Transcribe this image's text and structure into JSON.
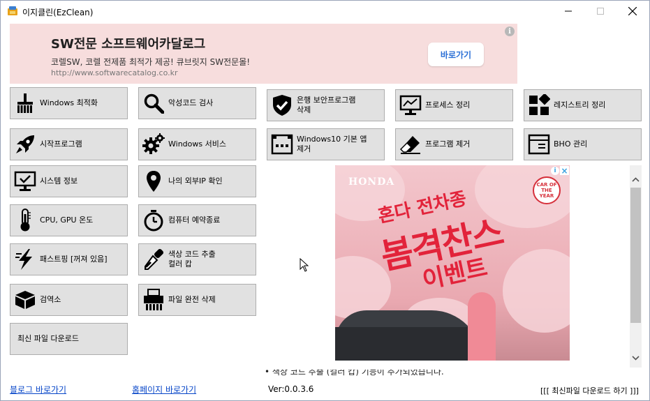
{
  "window": {
    "title": "이지클린(EzClean)"
  },
  "banner": {
    "title": "SW전문 소프트웨어카달로그",
    "subtitle": "코렐SW, 코렐 전제품 최적가 제공! 큐브릿지 SW전문몰!",
    "url": "http://www.softwarecatalog.co.kr",
    "button": "바로가기",
    "info": "i"
  },
  "tools": [
    {
      "label": "Windows 최적화",
      "icon": "broom-icon"
    },
    {
      "label": "악성코드 검사",
      "icon": "magnifier-icon"
    },
    {
      "label": "은행 보안프로그램\n삭제",
      "icon": "shield-check-icon"
    },
    {
      "label": "프로세스 정리",
      "icon": "monitor-chart-icon"
    },
    {
      "label": "레지스트리 정리",
      "icon": "registry-blocks-icon"
    },
    {
      "label": "시작프로그램",
      "icon": "rocket-icon"
    },
    {
      "label": "Windows 서비스",
      "icon": "gears-icon"
    },
    {
      "label": "Windows10 기본 앱\n제거",
      "icon": "app-window-icon"
    },
    {
      "label": "프로그램 제거",
      "icon": "eraser-icon"
    },
    {
      "label": "BHO 관리",
      "icon": "browser-window-icon"
    },
    {
      "label": "시스템 정보",
      "icon": "monitor-info-icon"
    },
    {
      "label": "나의 외부IP 확인",
      "icon": "location-pin-icon"
    },
    {
      "label": "CPU, GPU 온도",
      "icon": "thermometer-icon"
    },
    {
      "label": "컴퓨터 예약종료",
      "icon": "timer-icon"
    },
    {
      "label": "패스트핑 [꺼져 있음]",
      "icon": "lightning-icon"
    },
    {
      "label": "색상 코드 추출\n컬러 캅",
      "icon": "eyedropper-icon"
    },
    {
      "label": "검역소",
      "icon": "box-icon"
    },
    {
      "label": "파일 완전 삭제",
      "icon": "shredder-icon"
    },
    {
      "label": "최신 파일 다운로드",
      "icon": ""
    }
  ],
  "ad": {
    "brand": "HONDA",
    "line1": "혼다 전차종",
    "line2": "봄격찬스",
    "line3": "이벤트",
    "badge": "CAR OF THE YEAR"
  },
  "ticker": "• 색상 코드 추출 (컬러 캅) 기능이 추가되었습니다.",
  "footer": {
    "blog_link": "블로그 바로가기",
    "home_link": "홈페이지 바로가기",
    "version": "Ver:0.0.3.6",
    "download": "[[[ 최신파일 다운로드 하기 ]]]"
  },
  "colors": {
    "banner_bg": "#f7dddd",
    "button_bg": "#e1e1e1",
    "link": "#0645c8",
    "ad_red": "#e2233a"
  }
}
